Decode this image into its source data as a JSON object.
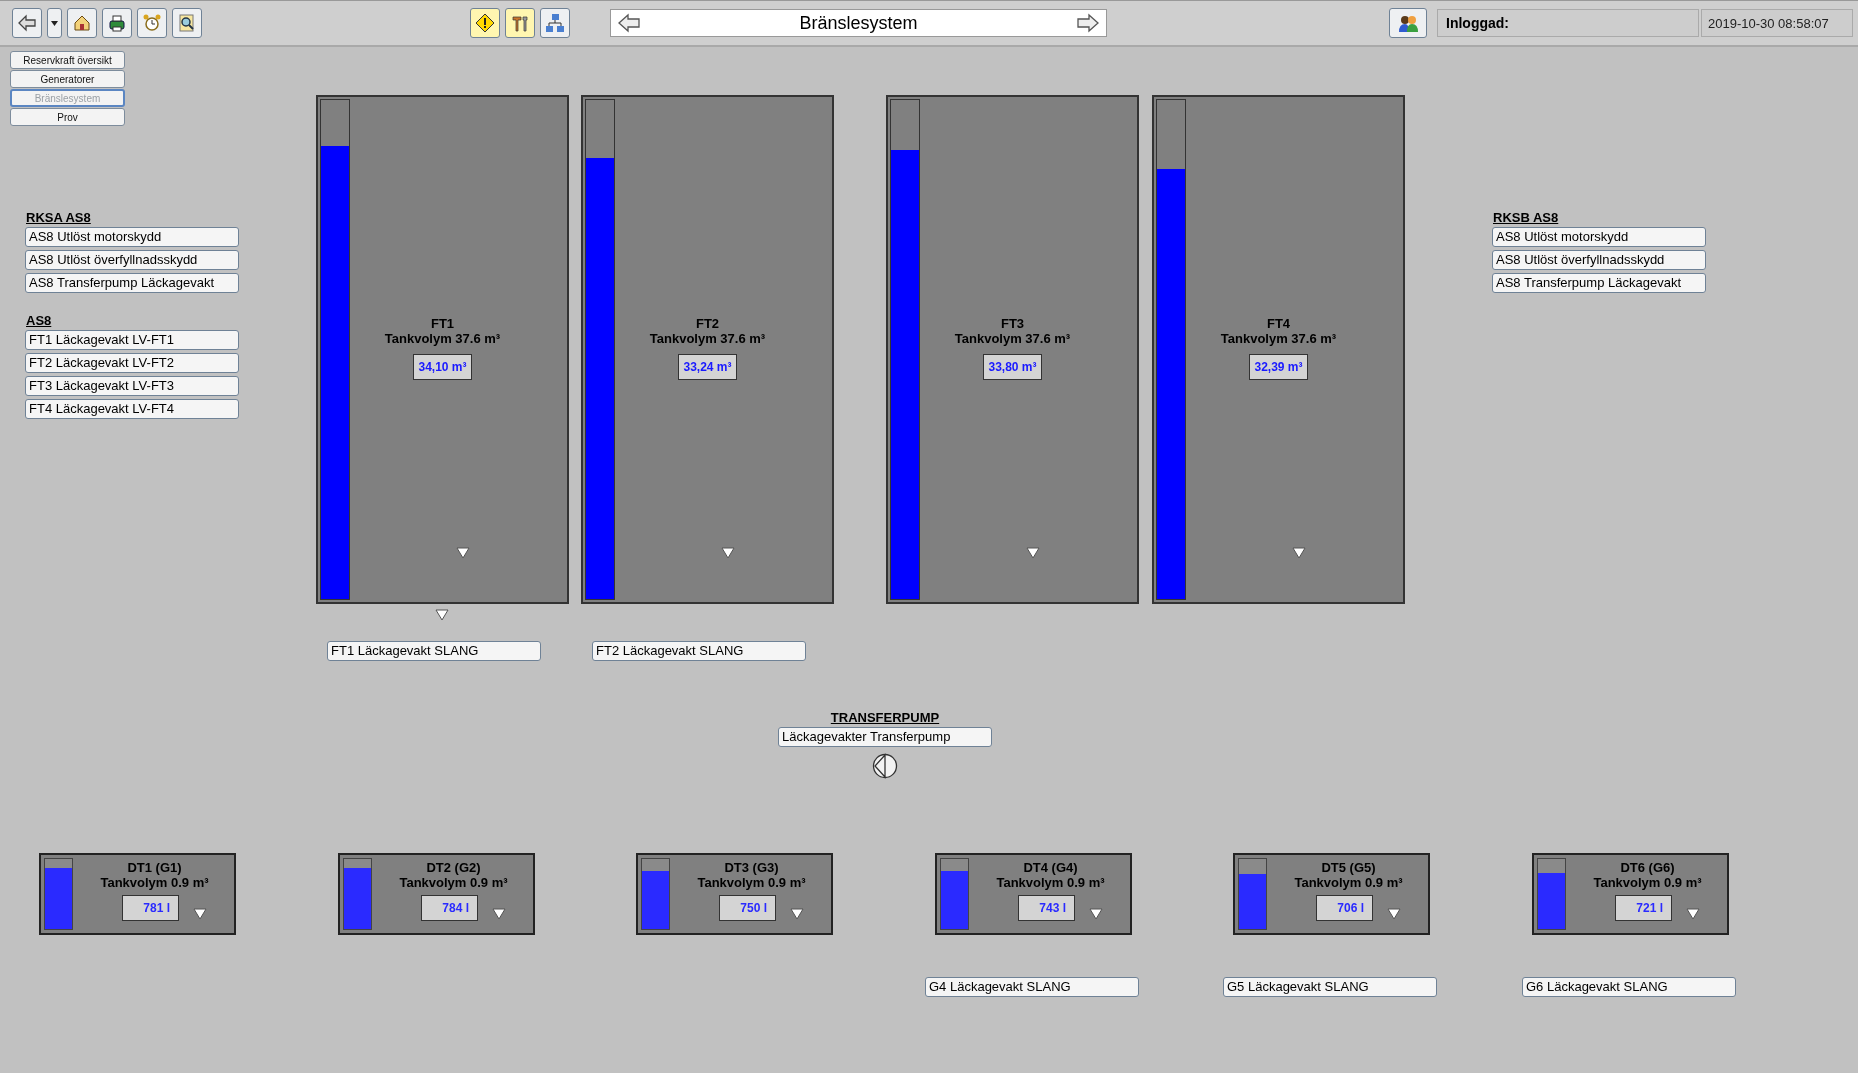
{
  "toolbar": {
    "title": "Bränslesystem",
    "user_label": "Inloggad:",
    "datetime": "2019-10-30 08:58:07"
  },
  "nav_buttons": [
    {
      "label": "Reservkraft översikt",
      "selected": false
    },
    {
      "label": "Generatorer",
      "selected": false
    },
    {
      "label": "Bränslesystem",
      "selected": true
    },
    {
      "label": "Prov",
      "selected": false
    }
  ],
  "left_panel": {
    "groups": [
      {
        "title": "RKSA AS8",
        "alarms": [
          "AS8 Utlöst motorskydd",
          "AS8 Utlöst överfyllnadsskydd",
          "AS8 Transferpump Läckagevakt"
        ]
      },
      {
        "title": "AS8",
        "alarms": [
          "FT1 Läckagevakt LV-FT1",
          "FT2 Läckagevakt LV-FT2",
          "FT3 Läckagevakt LV-FT3",
          "FT4 Läckagevakt LV-FT4"
        ]
      }
    ]
  },
  "main_tanks": [
    {
      "name": "FT1",
      "capacity": "Tankvolym 37.6 m³",
      "volume": "34,10 m³",
      "level": 0.907,
      "outlet_marker": true,
      "hose_alarm": "FT1 Läckagevakt SLANG"
    },
    {
      "name": "FT2",
      "capacity": "Tankvolym 37.6 m³",
      "volume": "33,24 m³",
      "level": 0.884,
      "outlet_marker": false,
      "hose_alarm": "FT2 Läckagevakt SLANG"
    },
    {
      "name": "FT3",
      "capacity": "Tankvolym 37.6 m³",
      "volume": "33,80 m³",
      "level": 0.899,
      "outlet_marker": false
    },
    {
      "name": "FT4",
      "capacity": "Tankvolym 37.6 m³",
      "volume": "32,39 m³",
      "level": 0.861,
      "outlet_marker": false
    }
  ],
  "right_panel": {
    "groups": [
      {
        "title": "RKSB AS8",
        "alarms": [
          "AS8 Utlöst motorskydd",
          "AS8 Utlöst överfyllnadsskydd",
          "AS8 Transferpump Läckagevakt"
        ]
      }
    ]
  },
  "transfer_pump": {
    "title": "TRANSFERPUMP",
    "alarm": "Läckagevakter Transferpump"
  },
  "day_tanks": [
    {
      "name": "DT1 (G1)",
      "capacity": "Tankvolym 0.9 m³",
      "volume": "781 l",
      "level": 0.868
    },
    {
      "name": "DT2 (G2)",
      "capacity": "Tankvolym 0.9 m³",
      "volume": "784 l",
      "level": 0.871
    },
    {
      "name": "DT3 (G3)",
      "capacity": "Tankvolym 0.9 m³",
      "volume": "750 l",
      "level": 0.833
    },
    {
      "name": "DT4 (G4)",
      "capacity": "Tankvolym 0.9 m³",
      "volume": "743 l",
      "level": 0.826,
      "hose_alarm": "G4 Läckagevakt SLANG"
    },
    {
      "name": "DT5 (G5)",
      "capacity": "Tankvolym 0.9 m³",
      "volume": "706 l",
      "level": 0.784,
      "hose_alarm": "G5 Läckagevakt SLANG"
    },
    {
      "name": "DT6 (G6)",
      "capacity": "Tankvolym 0.9 m³",
      "volume": "721 l",
      "level": 0.801,
      "hose_alarm": "G6 Läckagevakt SLANG"
    }
  ]
}
